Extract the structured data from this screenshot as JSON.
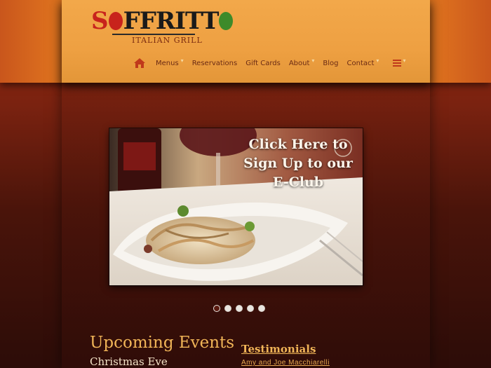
{
  "brand": {
    "logo_word": "SOFFRITTO",
    "logo_subtitle": "ITALIAN GRILL"
  },
  "nav": {
    "items": [
      {
        "label": "Menus",
        "has_dropdown": true
      },
      {
        "label": "Reservations",
        "has_dropdown": false
      },
      {
        "label": "Gift Cards",
        "has_dropdown": false
      },
      {
        "label": "About",
        "has_dropdown": true
      },
      {
        "label": "Blog",
        "has_dropdown": false
      },
      {
        "label": "Contact",
        "has_dropdown": true
      }
    ],
    "home_icon": "home-icon",
    "menu_icon": "hamburger-menu-icon"
  },
  "hero": {
    "caption_line1": "Click Here to",
    "caption_line2": "Sign Up to our",
    "caption_line3": "E-Club",
    "slide_count": 5,
    "active_slide": 1
  },
  "events": {
    "title": "Upcoming Events",
    "first_event": "Christmas Eve"
  },
  "testimonials": {
    "title": "Testimonials",
    "first_author": "Amy and Joe Macchiarelli"
  },
  "colors": {
    "header_orange": "#eea042",
    "nav_text": "#6a2a14",
    "accent_gold": "#f0b457",
    "logo_red": "#c8231c",
    "logo_green": "#3d8a2a"
  }
}
